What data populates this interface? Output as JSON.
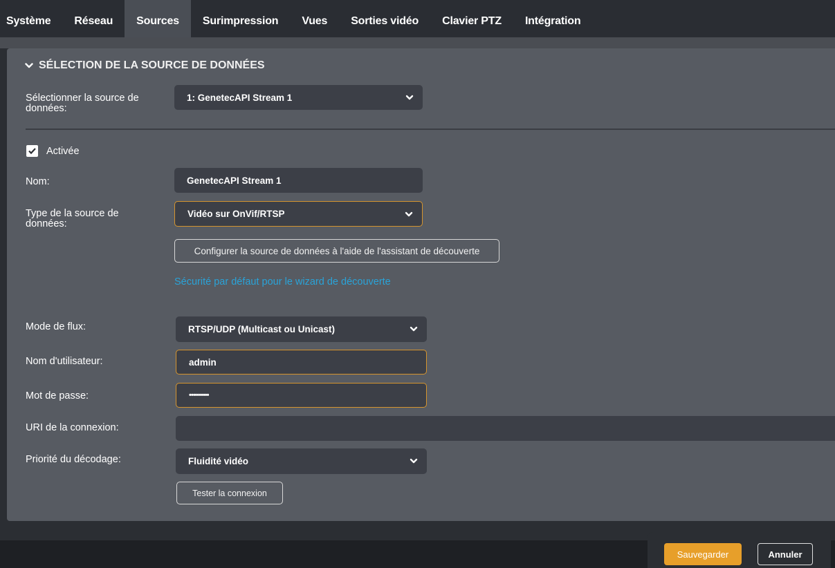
{
  "tabs": [
    {
      "label": "Système"
    },
    {
      "label": "Réseau"
    },
    {
      "label": "Sources",
      "active": true
    },
    {
      "label": "Surimpression"
    },
    {
      "label": "Vues"
    },
    {
      "label": "Sorties vidéo"
    },
    {
      "label": "Clavier PTZ"
    },
    {
      "label": "Intégration"
    }
  ],
  "section": {
    "title": "SÉLECTION DE LA SOURCE DE DONNÉES"
  },
  "form": {
    "select_source_label": "Sélectionner la source de données:",
    "select_source_value": "1: GenetecAPI Stream 1",
    "enabled_label": "Activée",
    "enabled_checked": true,
    "name_label": "Nom:",
    "name_value": "GenetecAPI Stream 1",
    "source_type_label": "Type de la source de données:",
    "source_type_value": "Vidéo sur OnVif/RTSP",
    "discovery_button": "Configurer la source de données à l'aide de l'assistant de découverte",
    "security_link": "Sécurité par défaut pour le wizard de découverte",
    "stream_mode_label": "Mode de flux:",
    "stream_mode_value": "RTSP/UDP (Multicast ou Unicast)",
    "username_label": "Nom d'utilisateur:",
    "username_value": "admin",
    "password_label": "Mot de passe:",
    "password_value": "••••••••••",
    "uri_label": "URI de la connexion:",
    "uri_value": "",
    "decode_priority_label": "Priorité du décodage:",
    "decode_priority_value": "Fluidité vidéo",
    "test_button": "Tester la connexion"
  },
  "footer": {
    "save": "Sauvegarder",
    "cancel": "Annuler"
  },
  "colors": {
    "accent": "#e79f2a",
    "link": "#2aa3d8",
    "panel": "#575b62",
    "field": "#3c3f47"
  }
}
